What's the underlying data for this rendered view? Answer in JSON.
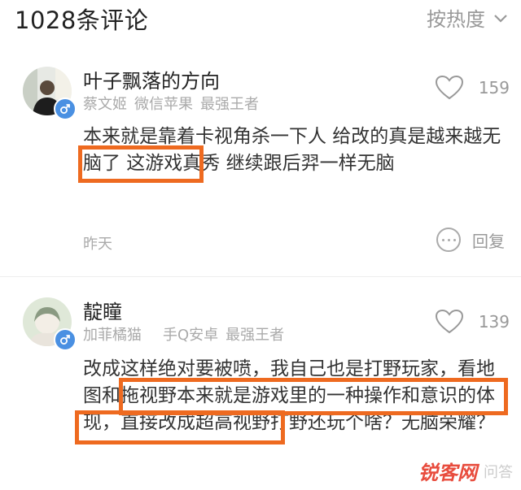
{
  "header": {
    "title": "1028条评论",
    "sort_label": "按热度"
  },
  "comments": [
    {
      "username": "叶子飘落的方向",
      "meta": [
        "蔡文姬",
        "微信苹果",
        "最强王者"
      ],
      "likes": "159",
      "body": "本来就是靠着卡视角杀一下人 给改的真是越来越无脑了 这游戏真秀 继续跟后羿一样无脑",
      "time": "昨天",
      "reply_label": "回复"
    },
    {
      "username": "靛瞳",
      "meta": [
        "加菲橘猫",
        "手Q安卓",
        "最强王者"
      ],
      "likes": "139",
      "body": "改成这样绝对要被喷，我自己也是打野玩家，看地图和拖视野本来就是游戏里的一种操作和意识的体现，直接改成超高视野打野还玩个啥？无脑荣耀？"
    }
  ],
  "watermark": {
    "brand": "锐客网",
    "suffix": "问答"
  },
  "colors": {
    "highlight": "#ee6a20",
    "gender_badge": "#4a90e2",
    "watermark": "#e84c3d"
  }
}
